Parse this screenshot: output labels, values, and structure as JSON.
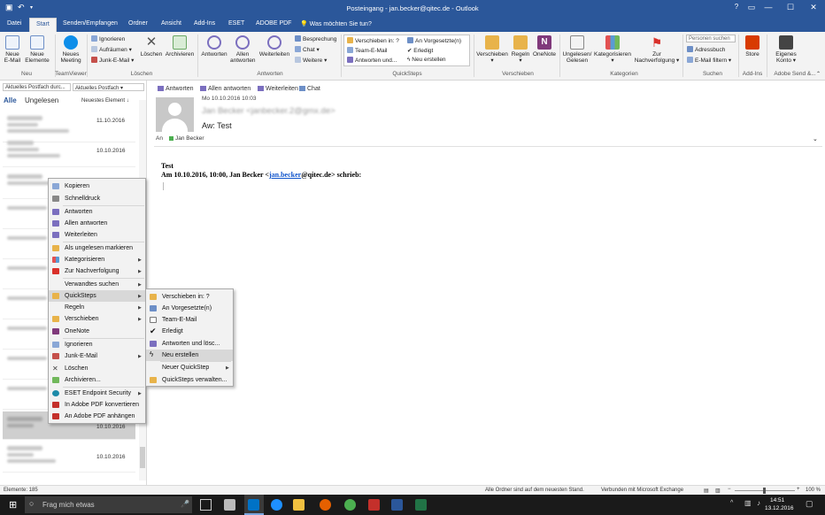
{
  "titlebar": {
    "title": "Posteingang - jan.becker@qitec.de - Outlook",
    "minimize": "—",
    "restore": "☐",
    "close": "✕",
    "help": "?",
    "undo": "↶",
    "quick_access": "▾"
  },
  "tabs": [
    "Datei",
    "Start",
    "Senden/Empfangen",
    "Ordner",
    "Ansicht",
    "Add-Ins",
    "ESET",
    "ADOBE PDF"
  ],
  "tell_me": "Was möchten Sie tun?",
  "ribbon": {
    "neu": {
      "new_email": "Neue E-Mail",
      "new_items": "Neue Elemente",
      "label": "Neu"
    },
    "teamviewer": {
      "meeting": "Neues Meeting",
      "label": "TeamViewer"
    },
    "loeschen": {
      "ignore": "Ignorieren",
      "cleanup": "Aufräumen",
      "junk": "Junk-E-Mail",
      "delete": "Löschen",
      "archive": "Archivieren",
      "label": "Löschen"
    },
    "antworten": {
      "reply": "Antworten",
      "reply_all": "Allen antworten",
      "forward": "Weiterleiten",
      "meeting": "Besprechung",
      "chat": "Chat",
      "more": "Weitere",
      "label": "Antworten"
    },
    "quicksteps": {
      "items": [
        "Verschieben in: ?",
        "An Vorgesetzte(n)",
        "Team-E-Mail",
        "Erledigt",
        "Antworten und...",
        "Neu erstellen"
      ],
      "label": "QuickSteps"
    },
    "verschieben": {
      "move": "Verschieben",
      "rules": "Regeln",
      "onenote": "OneNote",
      "label": "Verschieben"
    },
    "kategorien": {
      "unread": "Ungelesen/ Gelesen",
      "categorize": "Kategorisieren",
      "followup": "Zur Nachverfolgung",
      "label": "Kategorien"
    },
    "suchen": {
      "placeholder": "Personen suchen",
      "addressbook": "Adressbuch",
      "filter": "E-Mail filtern",
      "label": "Suchen"
    },
    "addins": {
      "store": "Store",
      "label": "Add-Ins"
    },
    "adobe": {
      "account": "Eigenes Konto",
      "label": "Adobe Send &..."
    }
  },
  "list": {
    "scope1": "Aktuelles Postfach durc...",
    "scope2": "Aktuelles Postfach",
    "filter_all": "Alle",
    "filter_unread": "Ungelesen",
    "sort": "Neuestes Element",
    "dates": [
      "11.10.2016",
      "10.10.2016",
      "10.10.2016",
      "10.10.2016"
    ]
  },
  "reading": {
    "actions": [
      "Antworten",
      "Allen antworten",
      "Weiterleiten",
      "Chat"
    ],
    "datetime": "Mo 10.10.2016 10:03",
    "sender": "Jan Becker <janbecker.2@gmx.de>",
    "subject": "Aw: Test",
    "to_label": "An",
    "to_name": "Jan Becker",
    "body_line1": "Test",
    "body_line2_prefix": "Am 10.10.2016, 10:00, Jan Becker <",
    "body_link": "jan.becker",
    "body_line2_suffix": "@qitec.de> schrieb:"
  },
  "context_menu": {
    "items": [
      "Kopieren",
      "Schnelldruck",
      "Antworten",
      "Allen antworten",
      "Weiterleiten",
      "Als ungelesen markieren",
      "Kategorisieren",
      "Zur Nachverfolgung",
      "Verwandtes suchen",
      "QuickSteps",
      "Regeln",
      "Verschieben",
      "OneNote",
      "Ignorieren",
      "Junk-E-Mail",
      "Löschen",
      "Archivieren...",
      "ESET Endpoint Security",
      "In Adobe PDF konvertieren",
      "An Adobe PDF anhängen"
    ],
    "highlighted": "QuickSteps"
  },
  "submenu": {
    "items": [
      "Verschieben in: ?",
      "An Vorgesetzte(n)",
      "Team-E-Mail",
      "Erledigt",
      "Antworten und lösc...",
      "Neu erstellen",
      "Neuer QuickStep",
      "QuickSteps verwalten..."
    ],
    "highlighted": "Neu erstellen"
  },
  "status": {
    "items": "Elemente: 185",
    "folders": "Alle Ordner sind auf dem neuesten Stand.",
    "exchange": "Verbunden mit Microsoft Exchange",
    "zoom": "100 %",
    "zoom_minus": "−",
    "zoom_plus": "+"
  },
  "taskbar": {
    "search": "Frag mich etwas",
    "time": "14:51",
    "date": "13.12.2016"
  },
  "colors": {
    "accent": "#2b579a",
    "menu_hover": "#d8d8d8",
    "taskbar": "#1a1a1a"
  }
}
